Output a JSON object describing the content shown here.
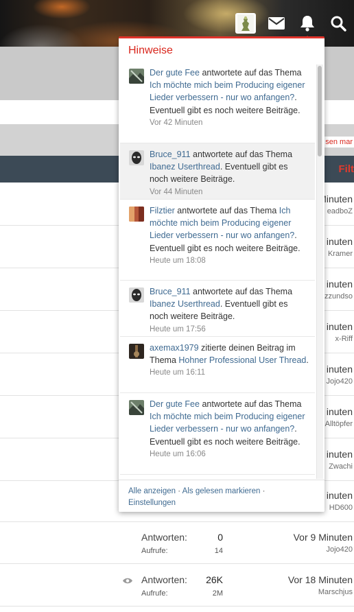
{
  "header": {
    "icons": [
      "user-avatar",
      "mail-icon",
      "bell-icon",
      "search-icon"
    ]
  },
  "page": {
    "mark_read_link": "sen mar",
    "filter_link": "Filt"
  },
  "threads": [
    {
      "time": "Minuten",
      "user": "eadboZ"
    },
    {
      "time": "inuten",
      "user": "Kramer"
    },
    {
      "time": "inuten",
      "user": "zzundso"
    },
    {
      "time": "inuten",
      "user": "x-Riff"
    },
    {
      "time": "inuten",
      "user": "Jojo420"
    },
    {
      "time": "inuten",
      "user": "Alltöpfer"
    },
    {
      "time": "inuten",
      "user": "Zwachi"
    },
    {
      "time": "inuten",
      "user": "HD600"
    },
    {
      "answers_label": "Antworten:",
      "answers": "0",
      "views_label": "Aufrufe:",
      "views": "14",
      "time": "Vor 9 Minuten",
      "user": "Jojo420"
    },
    {
      "answers_label": "Antworten:",
      "answers": "26K",
      "views_label": "Aufrufe:",
      "views": "2M",
      "time": "Vor 18 Minuten",
      "user": "Marschjus"
    }
  ],
  "notifications": {
    "title": "Hinweise",
    "items": [
      {
        "user": "Der gute Fee",
        "action": " antwortete auf das Thema ",
        "thread": "Ich möchte mich beim Producing eigener Lieder verbessern - nur wo anfangen?",
        "tail": ". Eventuell gibt es noch weitere Beiträge.",
        "time": "Vor 42 Minuten",
        "avatar": "avatar-landscape"
      },
      {
        "user": "Bruce_911",
        "action": " antwortete auf das Thema ",
        "thread": "Ibanez Userthread",
        "tail": ". Eventuell gibt es noch weitere Beiträge.",
        "time": "Vor 44 Minuten",
        "avatar": "avatar-face"
      },
      {
        "user": "Filztier",
        "action": " antwortete auf das Thema ",
        "thread": "Ich möchte mich beim Producing eigener Lieder verbessern - nur wo anfangen?",
        "tail": ". Eventuell gibt es noch weitere Beiträge.",
        "time": "Heute um 18:08",
        "avatar": "avatar-red"
      },
      {
        "user": "Bruce_911",
        "action": " antwortete auf das Thema ",
        "thread": "Ibanez Userthread",
        "tail": ". Eventuell gibt es noch weitere Beiträge.",
        "time": "Heute um 17:56",
        "avatar": "avatar-face"
      },
      {
        "user": "axemax1979",
        "action": " zitierte deinen Beitrag im Thema ",
        "thread": "Hohner Professional User Thread",
        "tail": ".",
        "time": "Heute um 16:11",
        "avatar": "avatar-dark"
      },
      {
        "user": "Der gute Fee",
        "action": " antwortete auf das Thema ",
        "thread": "Ich möchte mich beim Producing eigener Lieder verbessern - nur wo anfangen?",
        "tail": ". Eventuell gibt es noch weitere Beiträge.",
        "time": "Heute um 16:06",
        "avatar": "avatar-landscape"
      }
    ],
    "footer": {
      "show_all": "Alle anzeigen",
      "sep": " · ",
      "mark_read": "Als gelesen markieren",
      "sep2": " · ",
      "settings": "Einstellungen"
    }
  },
  "colors": {
    "accent": "#e0332b",
    "link": "#3f6a91",
    "dark_bar": "#3c4a56"
  }
}
